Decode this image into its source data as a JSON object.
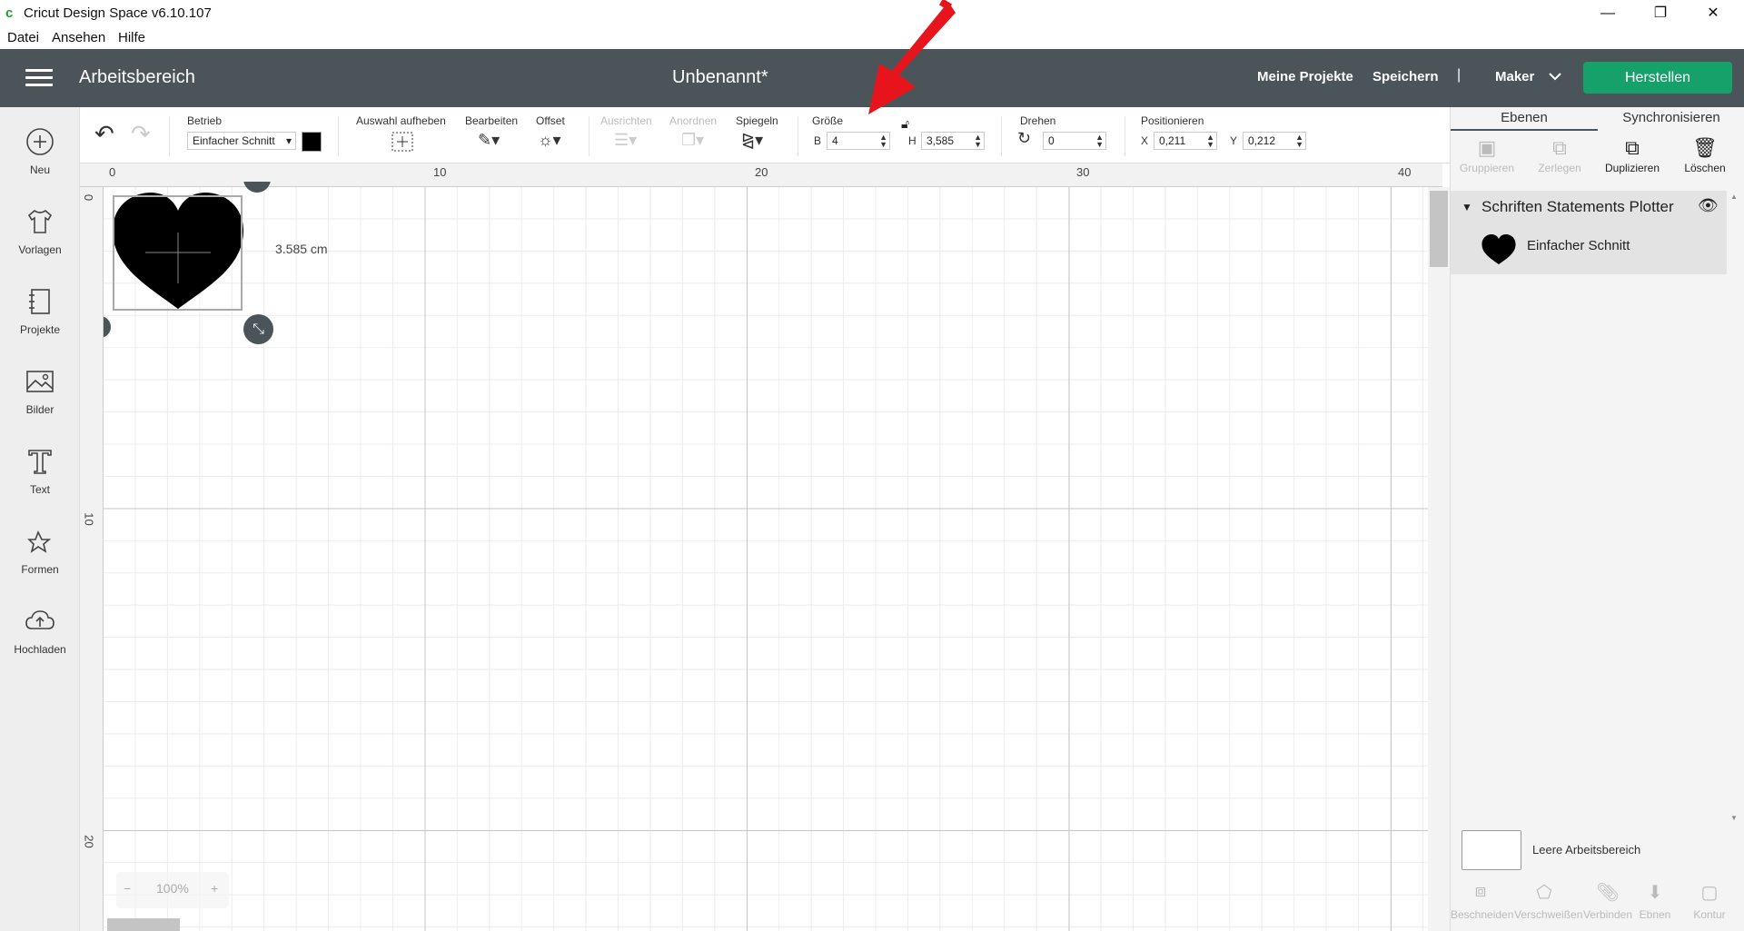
{
  "window": {
    "title": "Cricut Design Space  v6.10.107",
    "logo": "c",
    "controls": [
      "—",
      "❐",
      "✕"
    ]
  },
  "menu": [
    "Datei",
    "Ansehen",
    "Hilfe"
  ],
  "header": {
    "workspace": "Arbeitsbereich",
    "project": "Unbenannt*",
    "my_projects": "Meine Projekte",
    "save": "Speichern",
    "separator": "|",
    "machine": "Maker",
    "make": "Herstellen"
  },
  "leftnav": [
    {
      "label": "Neu",
      "icon": "plus-circle-icon"
    },
    {
      "label": "Vorlagen",
      "icon": "tshirt-icon"
    },
    {
      "label": "Projekte",
      "icon": "notebook-icon"
    },
    {
      "label": "Bilder",
      "icon": "image-icon"
    },
    {
      "label": "Text",
      "icon": "text-icon"
    },
    {
      "label": "Formen",
      "icon": "shapes-icon"
    },
    {
      "label": "Hochladen",
      "icon": "upload-cloud-icon"
    }
  ],
  "toolbar": {
    "operation_label": "Betrieb",
    "operation_value": "Einfacher Schnitt",
    "operation_color": "#000000",
    "deselect": "Auswahl aufheben",
    "edit": "Bearbeiten",
    "offset": "Offset",
    "align": "Ausrichten",
    "arrange": "Anordnen",
    "flip": "Spiegeln",
    "size": "Größe",
    "width_label": "B",
    "width_value": "4",
    "height_label": "H",
    "height_value": "3,585",
    "rotate": "Drehen",
    "rotate_value": "0",
    "position": "Positionieren",
    "x_label": "X",
    "x_value": "0,211",
    "y_label": "Y",
    "y_value": "0,212"
  },
  "ruler": {
    "h": [
      "0",
      "10",
      "20",
      "30",
      "40"
    ],
    "v": [
      "0",
      "10",
      "20"
    ]
  },
  "canvas": {
    "size_label": "3.585 cm",
    "zoom": "100%",
    "zoom_minus": "−",
    "zoom_plus": "+"
  },
  "layers": {
    "tab_layers": "Ebenen",
    "tab_sync": "Synchronisieren",
    "actions": [
      "Gruppieren",
      "Zerlegen",
      "Duplizieren",
      "Löschen"
    ],
    "group_title": "Schriften Statements Plotter",
    "layer_name": "Einfacher Schnitt",
    "canvas_label": "Leere Arbeitsbereich",
    "bottom_actions": [
      "Beschneiden",
      "Verschweißen",
      "Verbinden",
      "Ebnen",
      "Kontur"
    ]
  },
  "colors": {
    "header": "#4b5459",
    "make_button": "#16a06a",
    "annotation_arrow": "#e8141c"
  }
}
